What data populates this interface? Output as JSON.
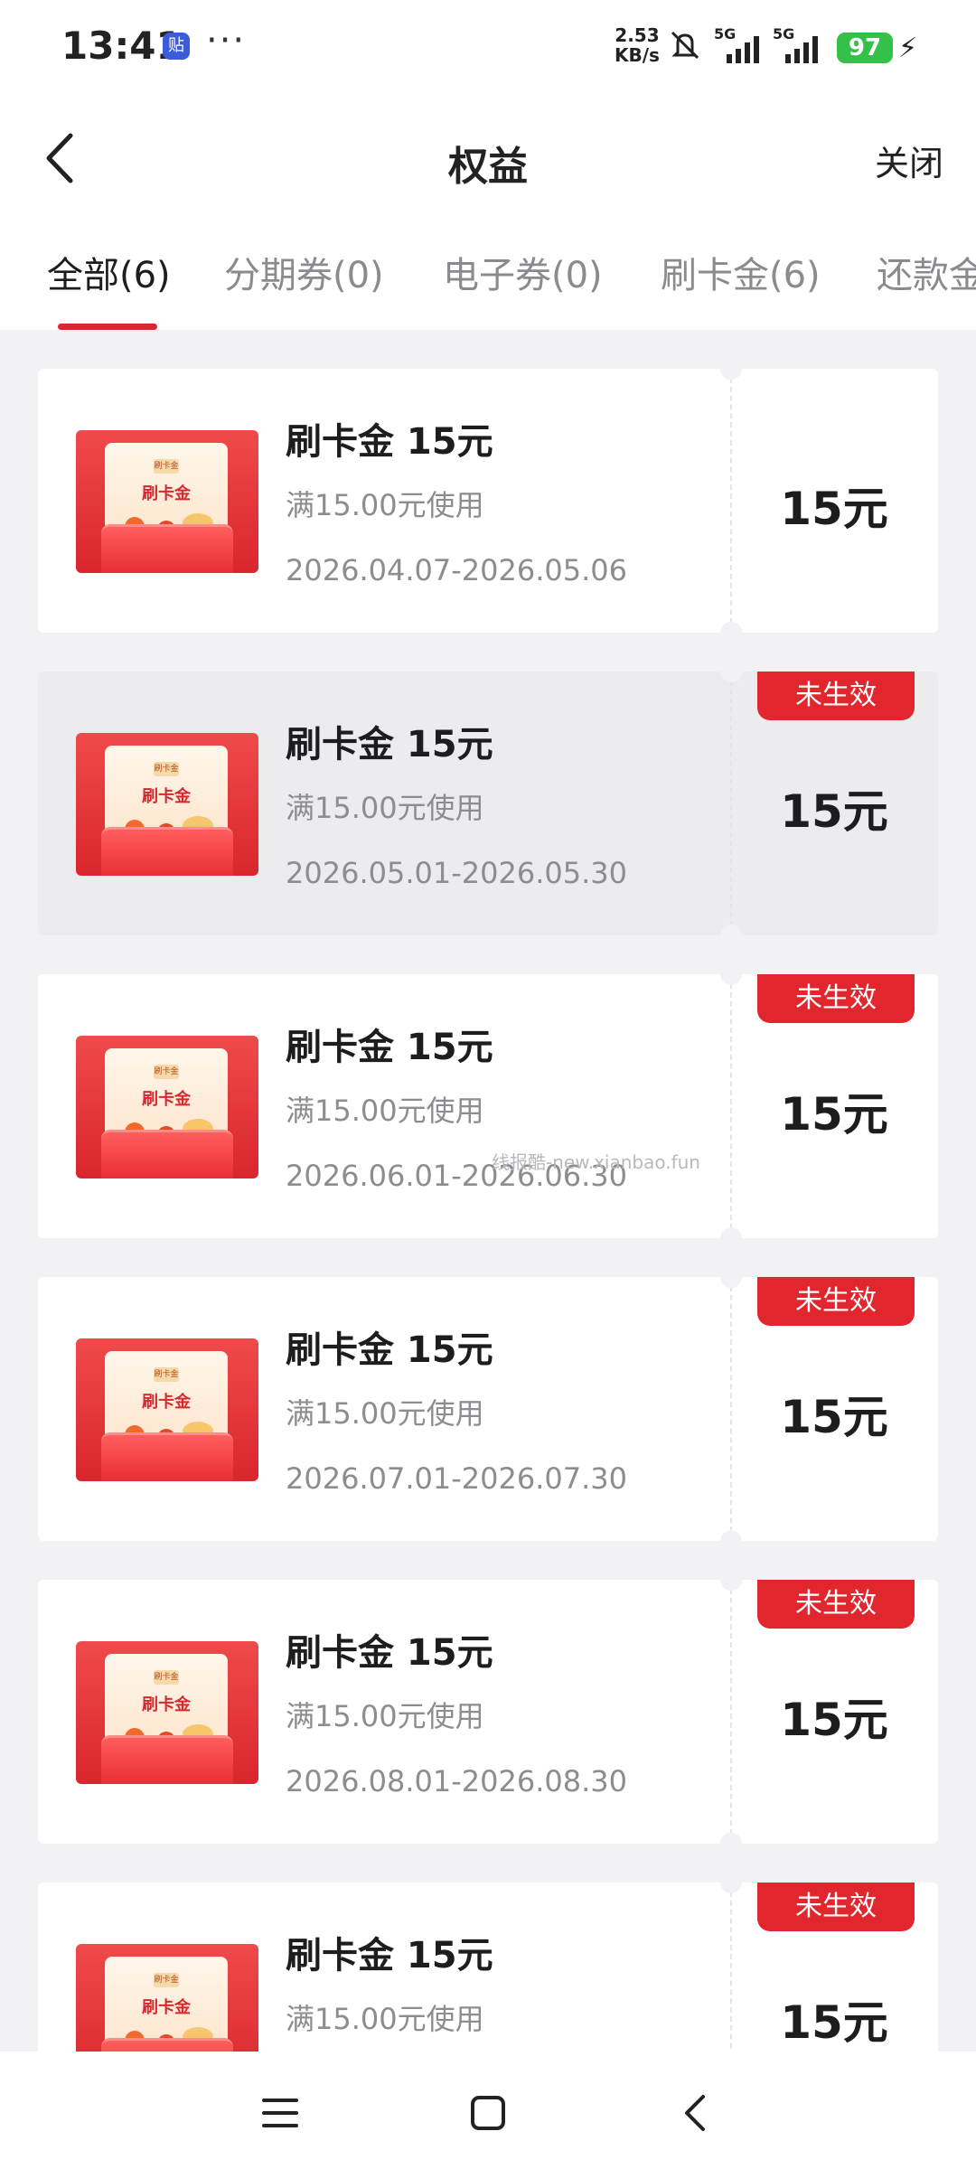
{
  "status_bar": {
    "time": "13:41",
    "app_badge": "贴",
    "dots": "···",
    "net_speed_value": "2.53",
    "net_speed_unit": "KB/s",
    "sim1_label": "5G",
    "sim2_label": "5G",
    "battery": "97"
  },
  "header": {
    "title": "权益",
    "close_label": "关闭"
  },
  "tabs": [
    {
      "label": "全部(6)",
      "active": true
    },
    {
      "label": "分期券(0)",
      "active": false
    },
    {
      "label": "电子券(0)",
      "active": false
    },
    {
      "label": "刷卡金(6)",
      "active": false
    },
    {
      "label": "还款金",
      "active": false
    }
  ],
  "thumbnail": {
    "tag": "刷卡金",
    "label": "刷卡金"
  },
  "coupons": [
    {
      "name": "刷卡金 15元",
      "condition": "满15.00元使用",
      "dates": "2026.04.07-2026.05.06",
      "amount": "15元",
      "badge": ""
    },
    {
      "name": "刷卡金 15元",
      "condition": "满15.00元使用",
      "dates": "2026.05.01-2026.05.30",
      "amount": "15元",
      "badge": "未生效"
    },
    {
      "name": "刷卡金 15元",
      "condition": "满15.00元使用",
      "dates": "2026.06.01-2026.06.30",
      "amount": "15元",
      "badge": "未生效"
    },
    {
      "name": "刷卡金 15元",
      "condition": "满15.00元使用",
      "dates": "2026.07.01-2026.07.30",
      "amount": "15元",
      "badge": "未生效"
    },
    {
      "name": "刷卡金 15元",
      "condition": "满15.00元使用",
      "dates": "2026.08.01-2026.08.30",
      "amount": "15元",
      "badge": "未生效"
    },
    {
      "name": "刷卡金 15元",
      "condition": "满15.00元使用",
      "dates": "",
      "amount": "15元",
      "badge": "未生效"
    }
  ],
  "watermark": "线报酷-new.xianbao.fun",
  "colors": {
    "accent": "#d7282f",
    "badge": "#e2262d",
    "background": "#f2f2f4",
    "battery": "#35c04a"
  },
  "icons": {
    "back": "chevron-left-icon",
    "menu": "menu-icon",
    "home": "home-square-icon",
    "nav_back": "back-icon"
  }
}
